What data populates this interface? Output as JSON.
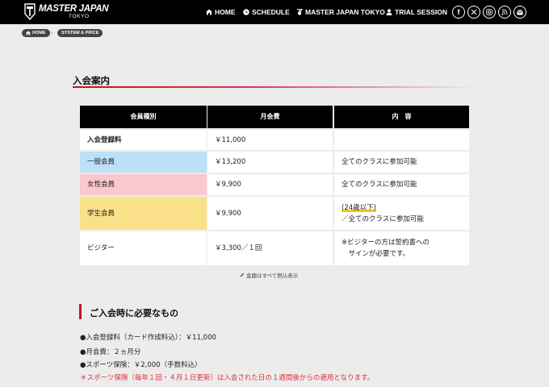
{
  "header": {
    "logo_text": "MASTER JAPAN",
    "logo_sub": "TOKYO",
    "nav": [
      {
        "label": "HOME",
        "icon": "home-icon"
      },
      {
        "label": "SCHEDULE",
        "icon": "clock-icon"
      },
      {
        "label": "MASTER JAPAN TOKYO",
        "icon": "trophy-icon"
      },
      {
        "label": "TRIAL SESSION",
        "icon": "person-icon"
      }
    ],
    "social": [
      "facebook-icon",
      "x-icon",
      "instagram-icon",
      "rss-icon",
      "mail-icon"
    ]
  },
  "breadcrumb": {
    "home": "HOME",
    "current": "SYSTEM & PRICE"
  },
  "section_title": "入会案内",
  "table": {
    "headers": [
      "会員種別",
      "月会費",
      "内　容"
    ],
    "rows": [
      {
        "type": "入会登録料",
        "fee": "￥11,000",
        "content": ""
      },
      {
        "type": "一般会員",
        "fee": "￥13,200",
        "content": "全てのクラスに参加可能"
      },
      {
        "type": "女性会員",
        "fee": "￥9,900",
        "content": "全てのクラスに参加可能"
      },
      {
        "type": "学生会員",
        "fee": "￥9,900",
        "content_line1": "(24歳以下)",
        "content_line2": "／全てのクラスに参加可能"
      },
      {
        "type": "ビジター",
        "fee": "￥3,300／１回",
        "content_line1": "※ビジターの方は誓約書への",
        "content_line2": "　サインが必要です。"
      }
    ],
    "note": "金額はすべて税込表示"
  },
  "requirements": {
    "title": "ご入会時に必要なもの",
    "lines": [
      "●入会登録料（カード作成料込）：￥11,000",
      "●月会費：２ヵ月分",
      "●スポーツ保険：￥2,000（手数料込）",
      "＊スポーツ保険（毎年１回・４月１日更新）は入会された日の１週間後からの適用となります。"
    ]
  },
  "colors": {
    "header_bg": "#000000",
    "accent_red": "#c8102e",
    "row_blue": "#bde0f9",
    "row_pink": "#f9c8cc",
    "row_yellow": "#fbe08a"
  }
}
